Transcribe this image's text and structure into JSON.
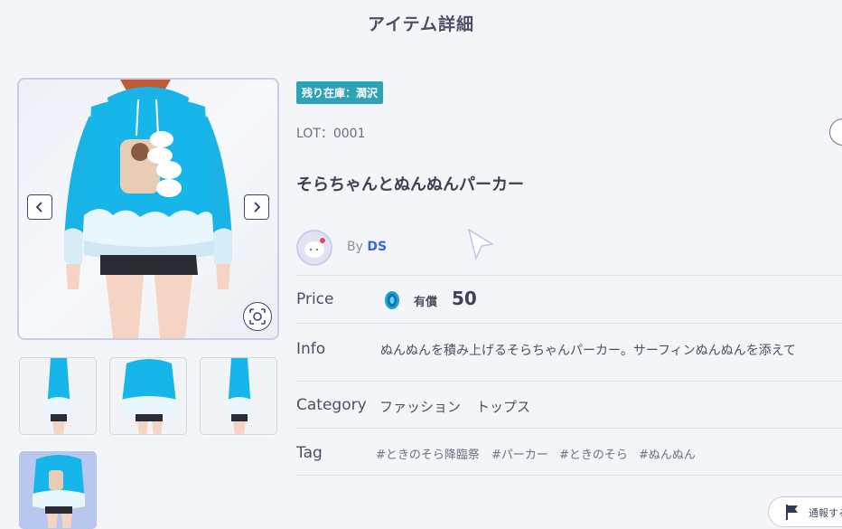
{
  "header": {
    "title": "アイテム詳細"
  },
  "item": {
    "stock_badge": "残り在庫：潤沢",
    "lot": "LOT：0001",
    "name": "そらちゃんとぬんぬんパーカー",
    "by_label": "By",
    "creator": "DS"
  },
  "details": {
    "price_label": "Price",
    "price_kind": "有償",
    "price_value": "50",
    "info_label": "Info",
    "info_text": "ぬんぬんを積み上げるそらちゃんパーカー。サーフィンぬんぬんを添えて",
    "category_label": "Category",
    "categories": [
      "ファッション",
      "トップス"
    ],
    "tag_label": "Tag",
    "tags": [
      "#ときのそら降臨祭",
      "#パーカー",
      "#ときのそら",
      "#ぬんぬん"
    ]
  },
  "report": {
    "label": "通報する"
  },
  "colors": {
    "badge": "#2ea3b8",
    "hoodie": "#17b6ea",
    "creator_link": "#3568d8"
  }
}
